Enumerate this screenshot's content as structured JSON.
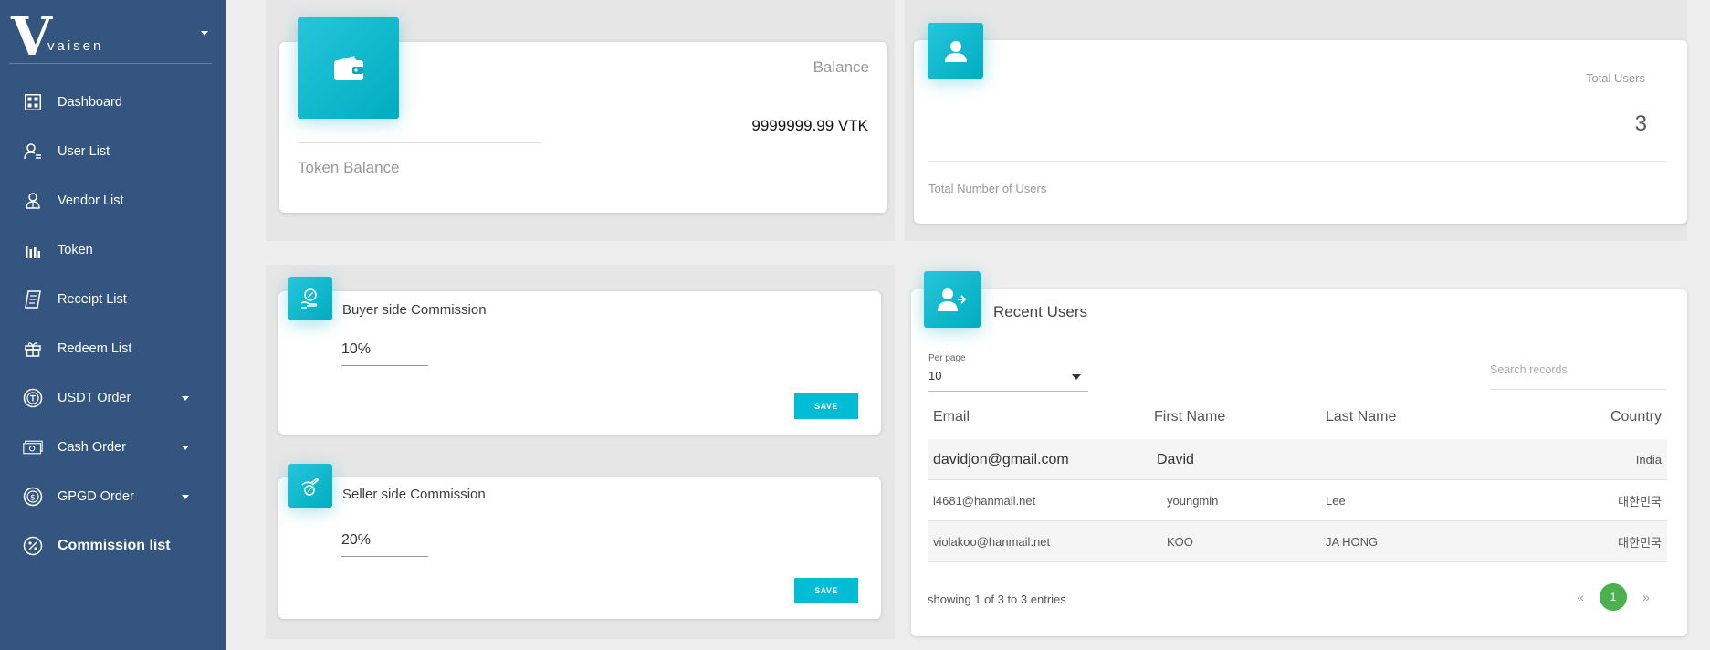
{
  "brand": {
    "logo_letter": "V",
    "name": "vaisen"
  },
  "sidebar": {
    "items": [
      {
        "label": "Dashboard"
      },
      {
        "label": "User List"
      },
      {
        "label": "Vendor List"
      },
      {
        "label": "Token"
      },
      {
        "label": "Receipt List"
      },
      {
        "label": "Redeem List"
      },
      {
        "label": "USDT Order"
      },
      {
        "label": "Cash Order"
      },
      {
        "label": "GPGD Order"
      },
      {
        "label": "Commission list"
      }
    ]
  },
  "balance_card": {
    "title": "Balance",
    "value": "9999999.99 VTK",
    "footer": "Token Balance"
  },
  "users_card": {
    "title": "Total Users",
    "value": "3",
    "footer": "Total Number of Users"
  },
  "buyer_commission": {
    "title": "Buyer side Commission",
    "value": "10%",
    "save_label": "SAVE"
  },
  "seller_commission": {
    "title": "Seller side Commission",
    "value": "20%",
    "save_label": "SAVE"
  },
  "recent_users": {
    "title": "Recent Users",
    "per_page_label": "Per page",
    "per_page_value": "10",
    "search_placeholder": "Search records",
    "columns": {
      "email": "Email",
      "first_name": "First Name",
      "last_name": "Last Name",
      "country": "Country"
    },
    "rows": [
      {
        "email": "davidjon@gmail.com",
        "first_name": "David",
        "last_name": "",
        "country": "India"
      },
      {
        "email": "l4681@hanmail.net",
        "first_name": "youngmin",
        "last_name": "Lee",
        "country": "대한민국"
      },
      {
        "email": "violakoo@hanmail.net",
        "first_name": "KOO",
        "last_name": "JA HONG",
        "country": "대한민국"
      }
    ],
    "showing_text": "showing 1 of 3 to 3 entries",
    "pagination": {
      "prev": "«",
      "current": "1",
      "next": "»"
    }
  },
  "colors": {
    "sidebar": "#34557f",
    "accent": "#00bcd4",
    "page_active": "#4caf50"
  }
}
